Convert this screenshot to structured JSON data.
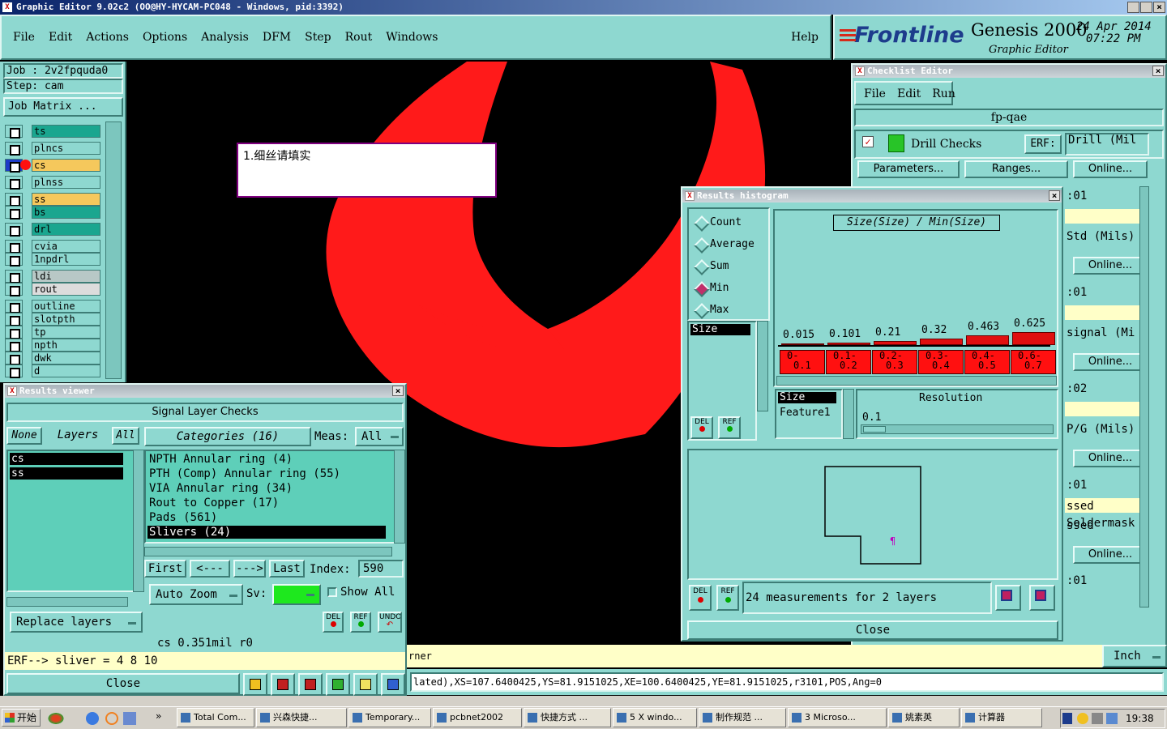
{
  "titlebar": {
    "text": "Graphic Editor 9.02c2 (OO@HY-HYCAM-PC048 - Windows, pid:3392)"
  },
  "menu": [
    "File",
    "Edit",
    "Actions",
    "Options",
    "Analysis",
    "DFM",
    "Step",
    "Rout",
    "Windows"
  ],
  "menu_help": "Help",
  "brand": {
    "logo": "Frontline",
    "product": "Genesis 2000",
    "subtitle": "Graphic Editor",
    "date": "24 Apr 2014",
    "time": "07:22 PM"
  },
  "job": {
    "job_line": "Job : 2v2fpquda0",
    "step_line": "Step: cam",
    "matrix_button": "Job Matrix ..."
  },
  "layers": [
    {
      "name": "ts",
      "color": "#1aa68f"
    },
    {
      "name": "plncs",
      "color": "#8ed8d0"
    },
    {
      "name": "cs",
      "color": "#f5c85c",
      "active": true
    },
    {
      "name": "plnss",
      "color": "#8ed8d0"
    },
    {
      "name": "ss",
      "color": "#f5c85c"
    },
    {
      "name": "bs",
      "color": "#1aa68f"
    },
    {
      "name": "drl",
      "color": "#1aa68f"
    },
    {
      "name": "cvia",
      "color": "#8ed8d0"
    },
    {
      "name": "1npdrl",
      "color": "#8ed8d0"
    },
    {
      "name": "ldi",
      "color": "#b8c8c6"
    },
    {
      "name": "rout",
      "color": "#dcdcdc"
    },
    {
      "name": "outline",
      "color": "#8ed8d0"
    },
    {
      "name": "slotpth",
      "color": "#8ed8d0"
    },
    {
      "name": "tp",
      "color": "#8ed8d0"
    },
    {
      "name": "npth",
      "color": "#8ed8d0"
    },
    {
      "name": "dwk",
      "color": "#8ed8d0"
    },
    {
      "name": "d",
      "color": "#8ed8d0"
    }
  ],
  "note": {
    "text": "1.细丝请填实"
  },
  "results_viewer": {
    "title": "Results viewer",
    "header": "Signal Layer Checks",
    "none_btn": "None",
    "layers_label": "Layers",
    "all_btn": "All",
    "categories_label": "Categories (16)",
    "meas_label": "Meas:",
    "meas_value": "All",
    "layer_list": [
      "cs",
      "ss"
    ],
    "categories": [
      "NPTH Annular ring (4)",
      "PTH (Comp) Annular ring (55)",
      "VIA Annular ring (34)",
      "Rout to Copper (17)",
      "Pads (561)",
      "Slivers (24)"
    ],
    "nav": {
      "first": "First",
      "prev": "<---",
      "next": "--->",
      "last": "Last",
      "index_label": "Index:",
      "index_value": "590"
    },
    "auto_zoom": "Auto Zoom",
    "sv_label": "Sv:",
    "show_all": "Show All",
    "replace_layers": "Replace layers",
    "del": "DEL",
    "ref": "REF",
    "undo": "UNDO",
    "status": "cs 0.351mil  r0",
    "erf": "ERF--> sliver = 4 8 10",
    "close": "Close"
  },
  "checklist_editor": {
    "title": "Checklist Editor",
    "menu": [
      "File",
      "Edit",
      "Run"
    ],
    "checklist_name": "fp-qae",
    "action_name": "Drill Checks",
    "erf_btn": "ERF:",
    "erf_value": "Drill (Mil",
    "parameters_btn": "Parameters...",
    "ranges_btn": "Ranges...",
    "online_btn": "Online...",
    "rows": [
      {
        "value": ":01",
        "label": "Std (Mils)"
      },
      {
        "value": ":01",
        "label": "signal (Mi"
      },
      {
        "value": ":02",
        "label": "P/G (Mils)"
      },
      {
        "value": ":01",
        "label": "ssed"
      },
      {
        "value": "",
        "label": "Soldermask"
      },
      {
        "value": ":01",
        "label": ""
      }
    ]
  },
  "histogram": {
    "title": "Results histogram",
    "modes": [
      "Count",
      "Average",
      "Sum",
      "Min",
      "Max"
    ],
    "selected_mode": "Min",
    "chart_title": "Size(Size) / Min(Size)",
    "list_item": "Size",
    "size_label": "Size",
    "feature_label": "Feature1",
    "resolution_label": "Resolution",
    "resolution_value": "0.1",
    "measurements": "24 measurements for 2 layers",
    "close": "Close",
    "del": "DEL",
    "ref": "REF"
  },
  "chart_data": {
    "type": "bar",
    "title": "Size(Size) / Min(Size)",
    "categories": [
      "0-0.1",
      "0.1-0.2",
      "0.2-0.3",
      "0.3-0.4",
      "0.4-0.5",
      "0.6-0.7"
    ],
    "values": [
      0.015,
      0.101,
      0.21,
      0.32,
      0.463,
      0.625
    ],
    "value_labels": [
      "0.015",
      "0.101",
      "0.21",
      "0.32",
      "0.463",
      "0.625"
    ],
    "bin_top": [
      "0-",
      "0.1-",
      "0.2-",
      "0.3-",
      "0.4-",
      "0.6-"
    ],
    "bin_bottom": [
      "0.1",
      "0.2",
      "0.3",
      "0.4",
      "0.5",
      "0.7"
    ],
    "ylim": [
      0,
      0.7
    ]
  },
  "bottom": {
    "corner_text": "rner",
    "unit": "Inch",
    "coords": "lated),XS=107.6400425,YS=81.9151025,XE=100.6400425,YE=81.9151025,r3101,POS,Ang=0"
  },
  "taskbar": {
    "start": "开始",
    "items": [
      "Total Com...",
      "兴森快捷...",
      "Temporary...",
      "pcbnet2002",
      "快捷方式 ...",
      "5 X windo...",
      "制作规范 ...",
      "3 Microso...",
      "姚素英",
      "计算器"
    ],
    "clock": "19:38"
  },
  "colors": {
    "teal": "#8ed8d0",
    "red": "#ff1a1a",
    "canvas": "#000000"
  }
}
